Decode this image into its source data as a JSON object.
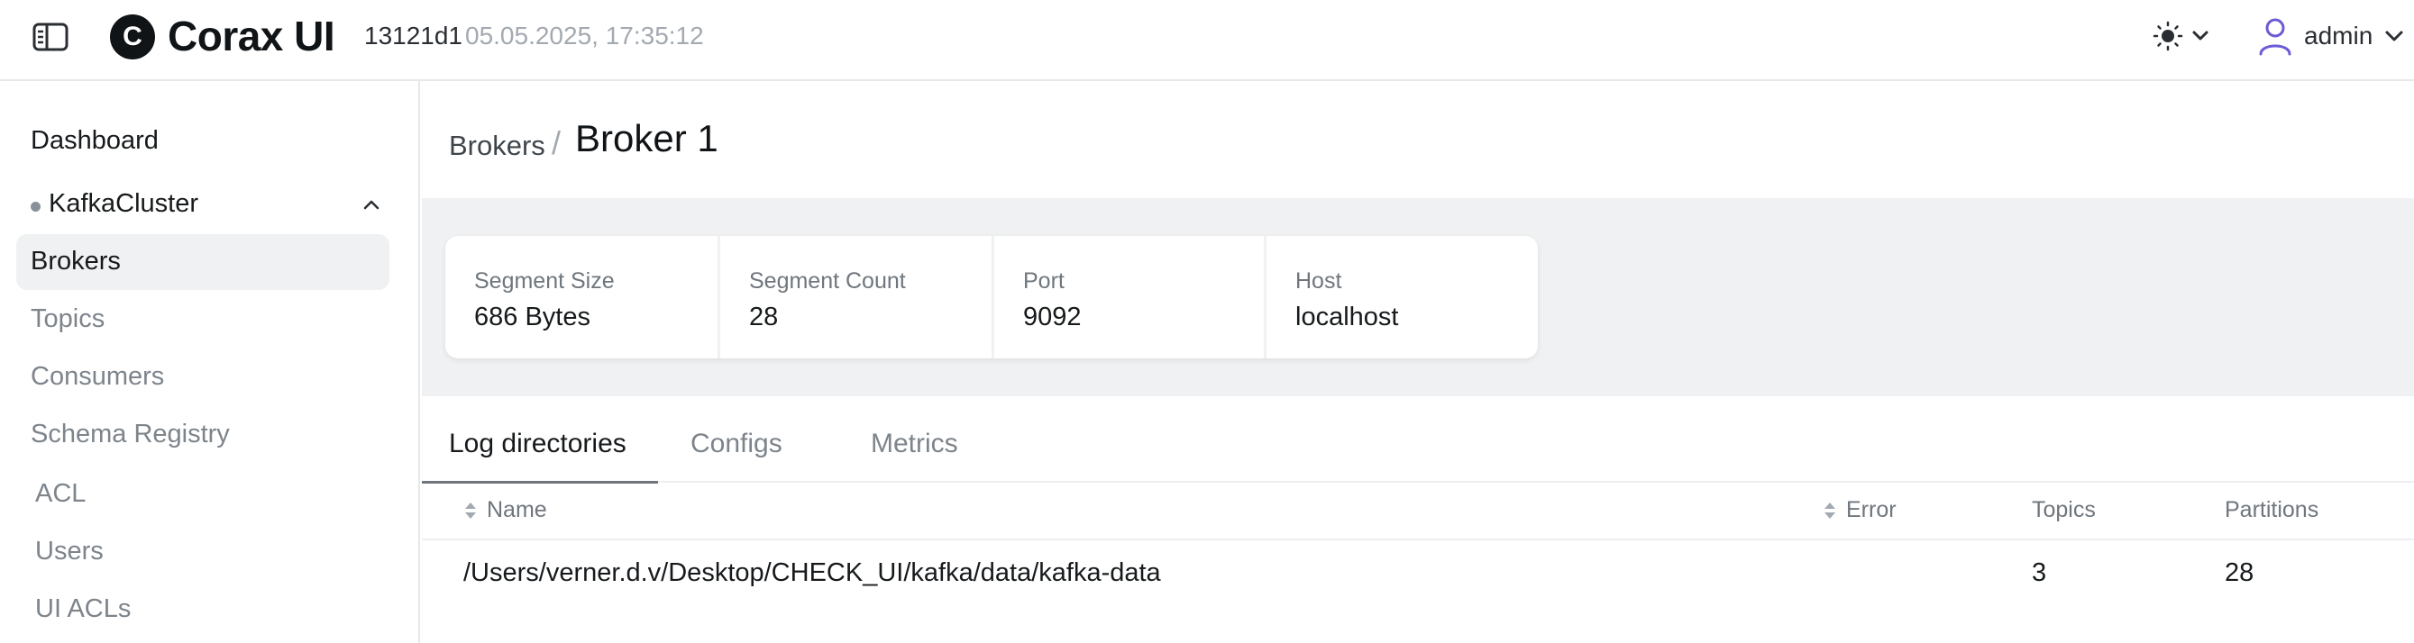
{
  "header": {
    "logo_letter": "C",
    "app_name": "Corax UI",
    "commit": "13121d1",
    "build_date": "05.05.2025, 17:35:12",
    "user": "admin"
  },
  "sidebar": {
    "dashboard": "Dashboard",
    "cluster": "KafkaCluster",
    "items": [
      "Brokers",
      "Topics",
      "Consumers",
      "Schema Registry",
      "ACL",
      "Users",
      "UI ACLs"
    ],
    "active_item": "Brokers"
  },
  "breadcrumb": {
    "parent": "Brokers",
    "separator": "/",
    "current": "Broker 1"
  },
  "stats": [
    {
      "label": "Segment Size",
      "value": "686 Bytes"
    },
    {
      "label": "Segment Count",
      "value": "28"
    },
    {
      "label": "Port",
      "value": "9092"
    },
    {
      "label": "Host",
      "value": "localhost"
    }
  ],
  "tabs": [
    {
      "label": "Log directories",
      "active": true
    },
    {
      "label": "Configs",
      "active": false
    },
    {
      "label": "Metrics",
      "active": false
    }
  ],
  "table": {
    "columns": [
      "Name",
      "Error",
      "Topics",
      "Partitions"
    ],
    "rows": [
      {
        "name": "/Users/verner.d.v/Desktop/CHECK_UI/kafka/data/kafka-data",
        "error": "",
        "topics": "3",
        "partitions": "28"
      }
    ]
  },
  "colors": {
    "active_tab_underline": "#6f767d",
    "user_icon": "#6b5bd6",
    "band_background": "#f0f1f2"
  }
}
